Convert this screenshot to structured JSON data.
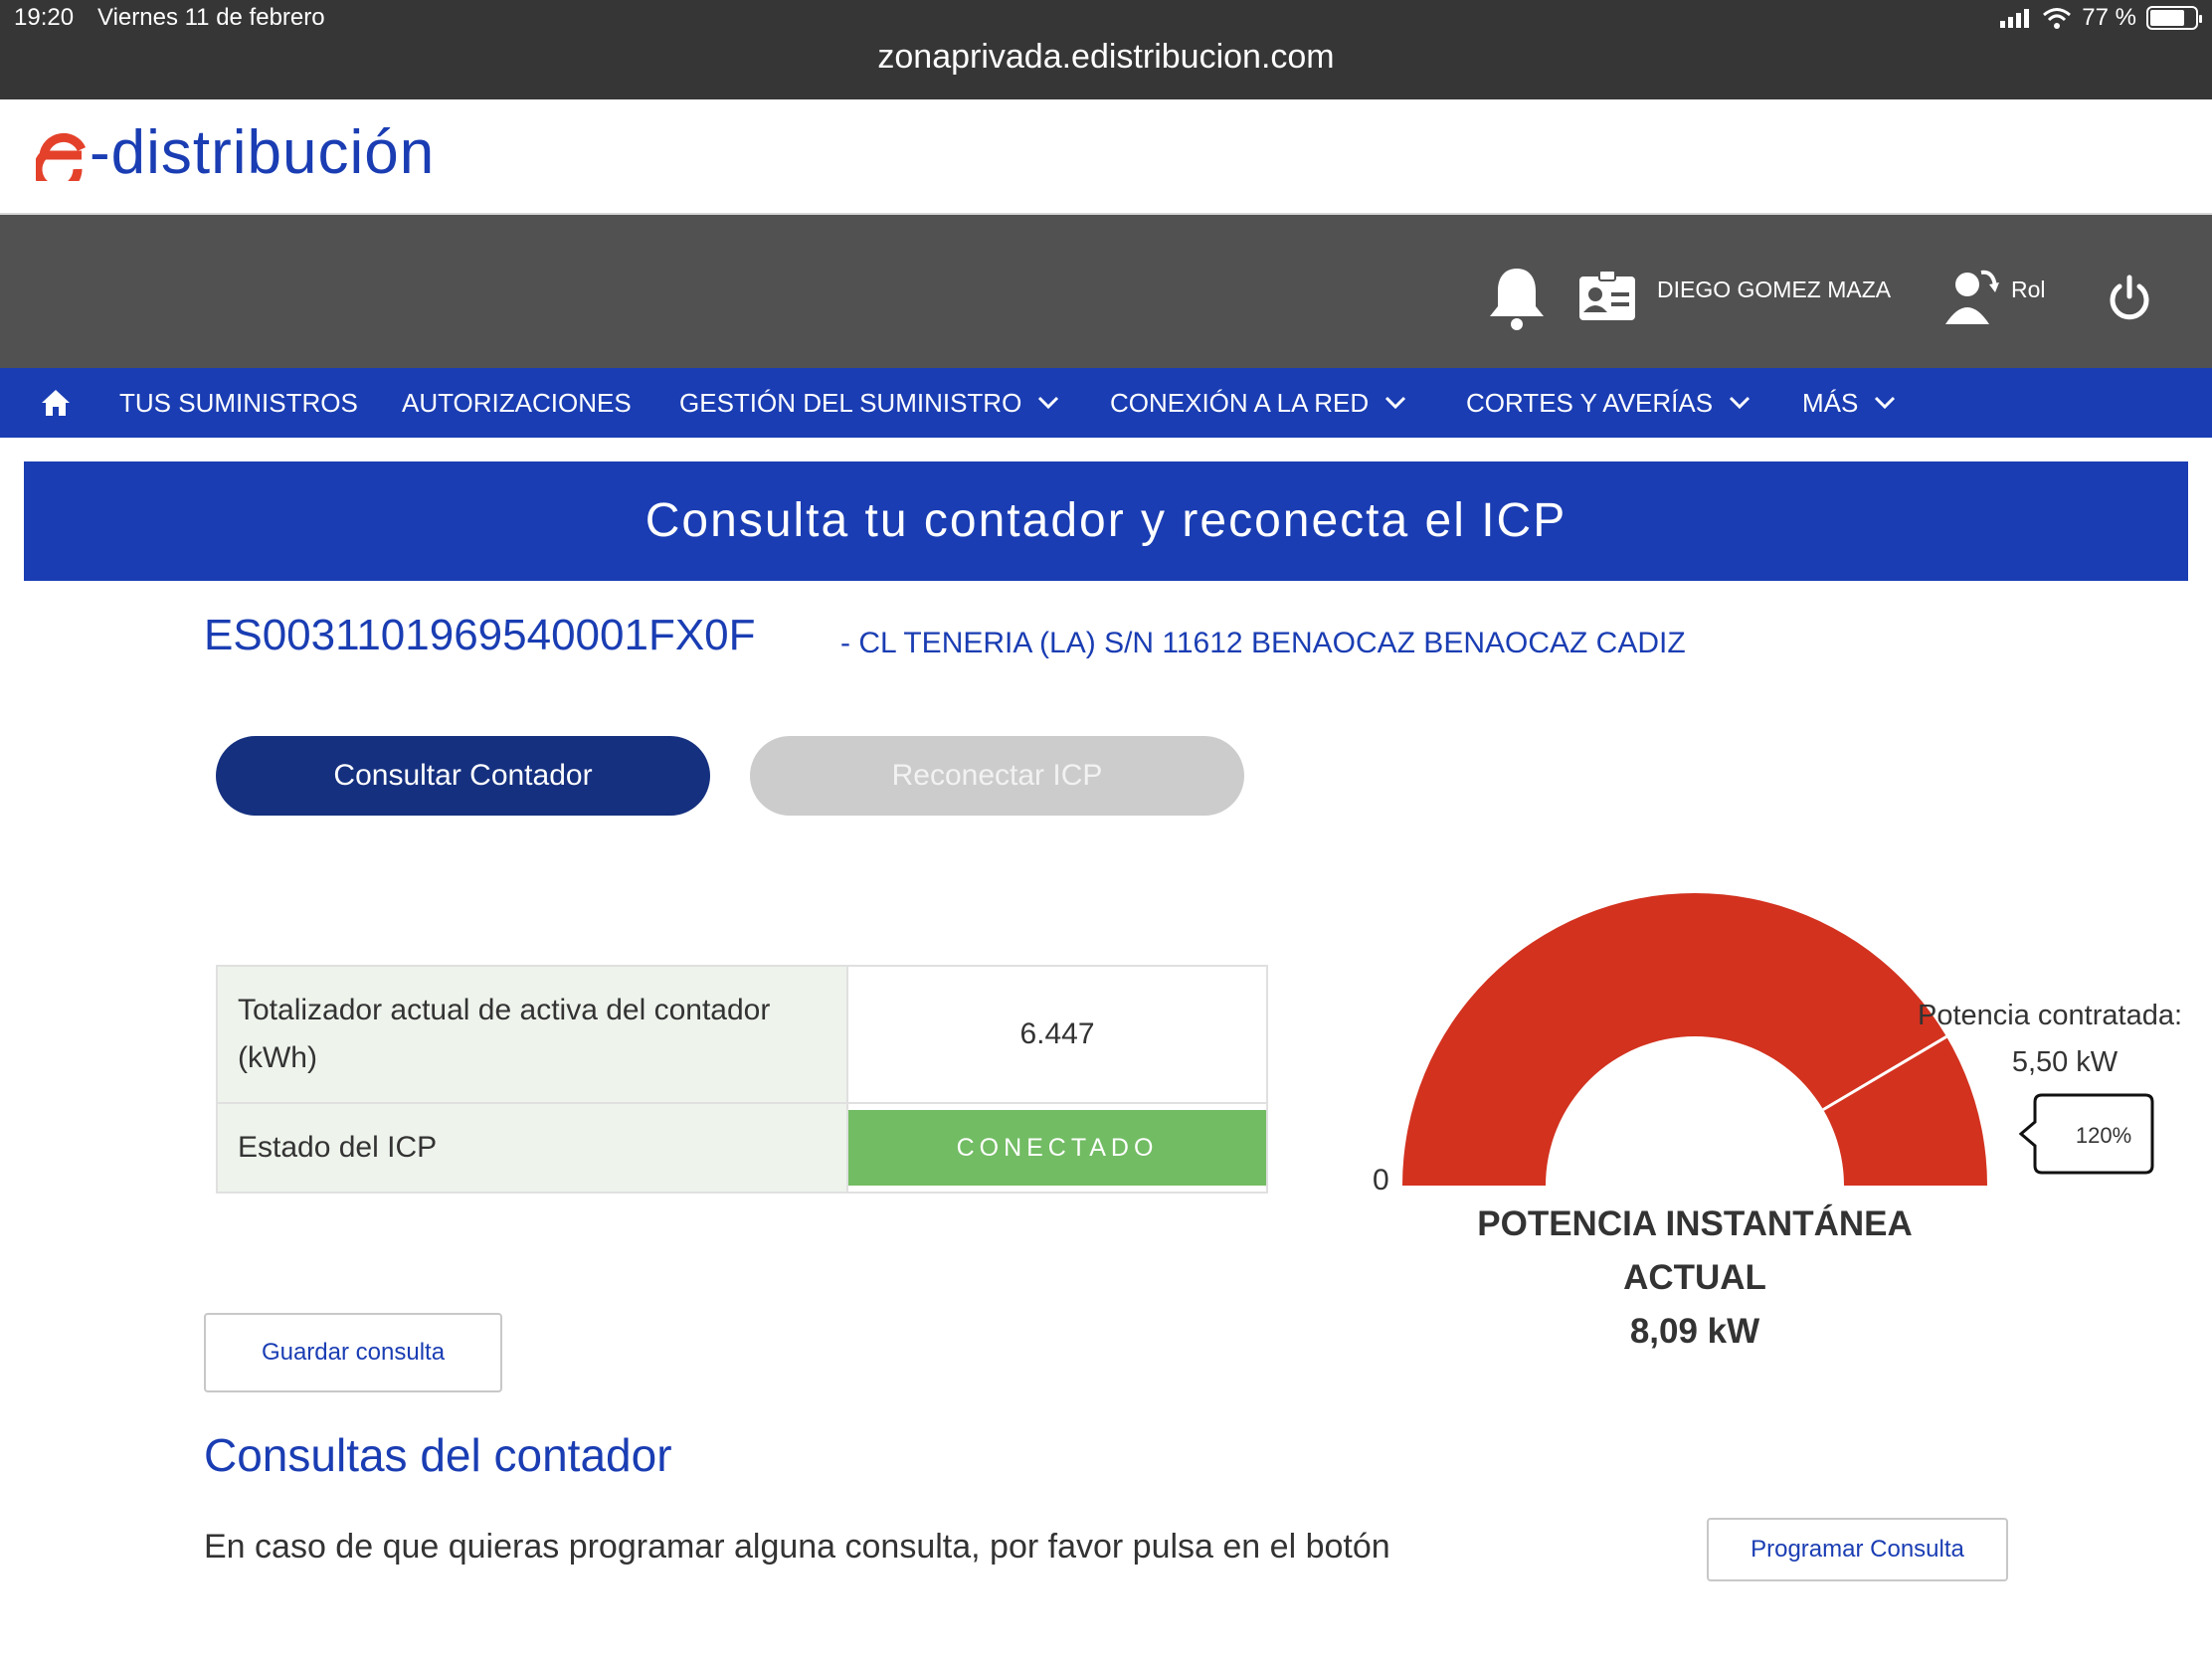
{
  "status_bar": {
    "time": "19:20",
    "date": "Viernes 11 de febrero",
    "battery": "77 %",
    "url": "zonaprivada.edistribucion.com"
  },
  "brand": {
    "logo_text": "-distribución",
    "colors": {
      "primary": "#1a3db3",
      "dark": "#15307f",
      "gauge": "#d3321f",
      "success": "#72bc63"
    }
  },
  "user_bar": {
    "user_name": "DIEGO GOMEZ MAZA",
    "rol_label": "Rol"
  },
  "nav": {
    "items": [
      {
        "label": "TUS SUMINISTROS"
      },
      {
        "label": "AUTORIZACIONES"
      },
      {
        "label": "GESTIÓN DEL SUMINISTRO"
      },
      {
        "label": "CONEXIÓN A LA RED"
      },
      {
        "label": "CORTES Y AVERÍAS"
      },
      {
        "label": "MÁS"
      }
    ]
  },
  "banner": {
    "title": "Consulta tu contador y reconecta el ICP"
  },
  "supply": {
    "cups": "ES0031101969540001FX0F",
    "address": "- CL TENERIA (LA) S/N 11612 BENAOCAZ BENAOCAZ CADIZ"
  },
  "actions": {
    "consult_label": "Consultar Contador",
    "reconnect_label": "Reconectar ICP"
  },
  "meter_table": {
    "row1_label": "Totalizador actual de activa del contador (kWh)",
    "row1_value": "6.447",
    "row2_label": "Estado del ICP",
    "row2_value": "CONECTADO"
  },
  "gauge": {
    "zero_label": "0",
    "contracted_label": "Potencia contratada:",
    "contracted_value": "5,50 kW",
    "percent": "120%",
    "title_line1": "POTENCIA INSTANTÁNEA",
    "title_line2": "ACTUAL",
    "current_value": "8,09 kW",
    "fill_fraction": 1.0,
    "contracted_fraction": 0.83
  },
  "save_label": "Guardar consulta",
  "section": {
    "title": "Consultas del contador",
    "text": "En caso de que quieras programar alguna consulta, por favor pulsa en el botón",
    "program_label": "Programar Consulta"
  }
}
